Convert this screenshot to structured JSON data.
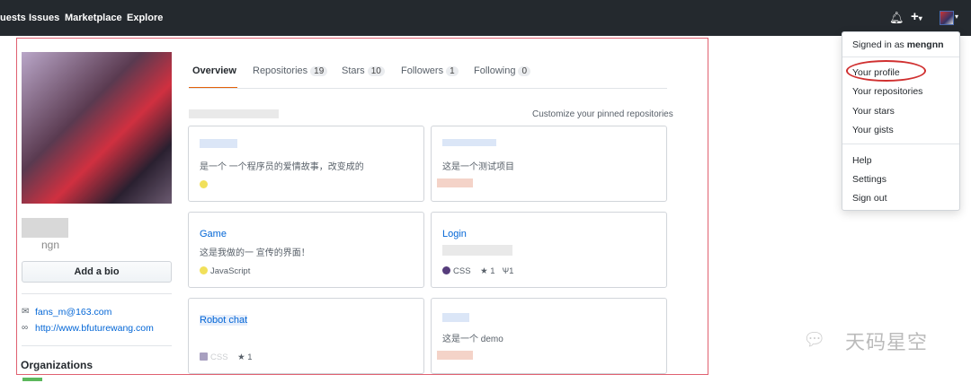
{
  "topbar": {
    "nav": [
      "uests",
      "Issues",
      "Marketplace",
      "Explore"
    ]
  },
  "profile": {
    "username_partial": "ngn",
    "add_bio": "Add a bio",
    "email": "fans_m@163.com",
    "website": "http://www.bfuturewang.com",
    "organizations": "Organizations"
  },
  "tabs": [
    {
      "label": "Overview",
      "active": true
    },
    {
      "label": "Repositories",
      "count": "19"
    },
    {
      "label": "Stars",
      "count": "10"
    },
    {
      "label": "Followers",
      "count": "1"
    },
    {
      "label": "Following",
      "count": "0"
    }
  ],
  "pinned": {
    "customize": "Customize your pinned repositories",
    "cards": [
      {
        "title": "",
        "desc": "是一个 一个程序员的爱情故事，改变成的",
        "lang": "",
        "color": "#f1e05a",
        "stars": "",
        "forks": ""
      },
      {
        "title": "",
        "desc": "这是一个测试项目",
        "lang": "",
        "color": "#e8a090",
        "stars": "",
        "forks": ""
      },
      {
        "title": "Game",
        "desc": "这是我做的一 宣传的界面！",
        "lang": "JavaScript",
        "color": "#f1e05a",
        "stars": "",
        "forks": ""
      },
      {
        "title": "Login",
        "desc": "",
        "lang": "CSS",
        "color": "#563d7c",
        "stars": "1",
        "forks": "1"
      },
      {
        "title": "Robot chat",
        "desc": "",
        "lang": "CSS",
        "color": "#563d7c",
        "stars": "1",
        "forks": ""
      },
      {
        "title": "",
        "desc": "这是一个 demo",
        "lang": "",
        "color": "#e8a090",
        "stars": "",
        "forks": ""
      }
    ]
  },
  "menu": {
    "signed_in_prefix": "Signed in as",
    "user": "mengnn",
    "items": [
      "Your profile",
      "Your repositories",
      "Your stars",
      "Your gists",
      "Help",
      "Settings",
      "Sign out"
    ]
  },
  "watermark": "天码星空"
}
